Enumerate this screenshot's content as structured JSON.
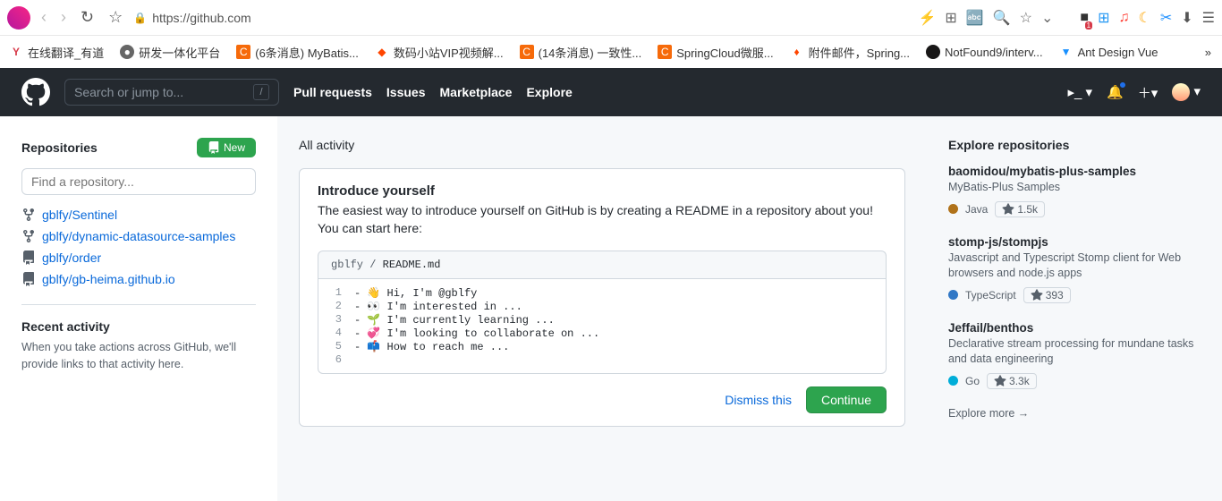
{
  "browser": {
    "url": "https://github.com",
    "toolbar_icons": [
      "⚡",
      "⊞",
      "🔤",
      "🔍",
      "☆",
      "⌄"
    ],
    "ext_icons": [
      {
        "glyph": "■",
        "color": "#333",
        "badge": "1"
      },
      {
        "glyph": "⊞",
        "color": "#2196f3"
      },
      {
        "glyph": "♫",
        "color": "#ff3b30"
      },
      {
        "glyph": "☾",
        "color": "#ffa500"
      },
      {
        "glyph": "✂",
        "color": "#1e90ff"
      },
      {
        "glyph": "⬇",
        "color": "#555"
      },
      {
        "glyph": "☰",
        "color": "#555"
      }
    ]
  },
  "bookmarks": [
    {
      "icon": "Y",
      "cls": "fav-red",
      "label": "在线翻译_有道"
    },
    {
      "icon": "●",
      "cls": "fav-gray",
      "label": "研发一体化平台"
    },
    {
      "icon": "C",
      "cls": "fav-orange",
      "label": "(6条消息) MyBatis..."
    },
    {
      "icon": "◆",
      "cls": "fav-flame",
      "label": "数码小站VIP视频解..."
    },
    {
      "icon": "C",
      "cls": "fav-orange",
      "label": "(14条消息) 一致性..."
    },
    {
      "icon": "C",
      "cls": "fav-orange",
      "label": "SpringCloud微服..."
    },
    {
      "icon": "♦",
      "cls": "fav-flame",
      "label": "附件邮件，Spring..."
    },
    {
      "icon": " ",
      "cls": "fav-gh",
      "label": "NotFound9/interv..."
    },
    {
      "icon": "▼",
      "cls": "fav-vue",
      "label": "Ant Design Vue"
    }
  ],
  "header": {
    "search_placeholder": "Search or jump to...",
    "nav": [
      "Pull requests",
      "Issues",
      "Marketplace",
      "Explore"
    ]
  },
  "sidebar": {
    "title": "Repositories",
    "new_label": "New",
    "find_placeholder": "Find a repository...",
    "repos": [
      {
        "icon": "fork",
        "name": "gblfy/Sentinel"
      },
      {
        "icon": "fork",
        "name": "gblfy/dynamic-datasource-samples"
      },
      {
        "icon": "repo",
        "name": "gblfy/order"
      },
      {
        "icon": "repo",
        "name": "gblfy/gb-heima.github.io"
      }
    ],
    "recent_title": "Recent activity",
    "recent_text": "When you take actions across GitHub, we'll provide links to that activity here."
  },
  "feed": {
    "title": "All activity",
    "intro_title": "Introduce yourself",
    "intro_text": "The easiest way to introduce yourself on GitHub is by creating a README in a repository about you! You can start here:",
    "readme_path_user": "gblfy",
    "readme_path_file": "README.md",
    "readme_lines": [
      "- 👋 Hi, I'm @gblfy",
      "- 👀 I'm interested in ...",
      "- 🌱 I'm currently learning ...",
      "- 💞️ I'm looking to collaborate on ...",
      "- 📫 How to reach me ..."
    ],
    "dismiss": "Dismiss this",
    "continue": "Continue"
  },
  "explore": {
    "title": "Explore repositories",
    "repos": [
      {
        "name": "baomidou/mybatis-plus-samples",
        "desc": "MyBatis-Plus Samples",
        "lang": "Java",
        "color": "#b07219",
        "stars": "1.5k"
      },
      {
        "name": "stomp-js/stompjs",
        "desc": "Javascript and Typescript Stomp client for Web browsers and node.js apps",
        "lang": "TypeScript",
        "color": "#3178c6",
        "stars": "393"
      },
      {
        "name": "Jeffail/benthos",
        "desc": "Declarative stream processing for mundane tasks and data engineering",
        "lang": "Go",
        "color": "#00ADD8",
        "stars": "3.3k"
      }
    ],
    "more": "Explore more →"
  }
}
